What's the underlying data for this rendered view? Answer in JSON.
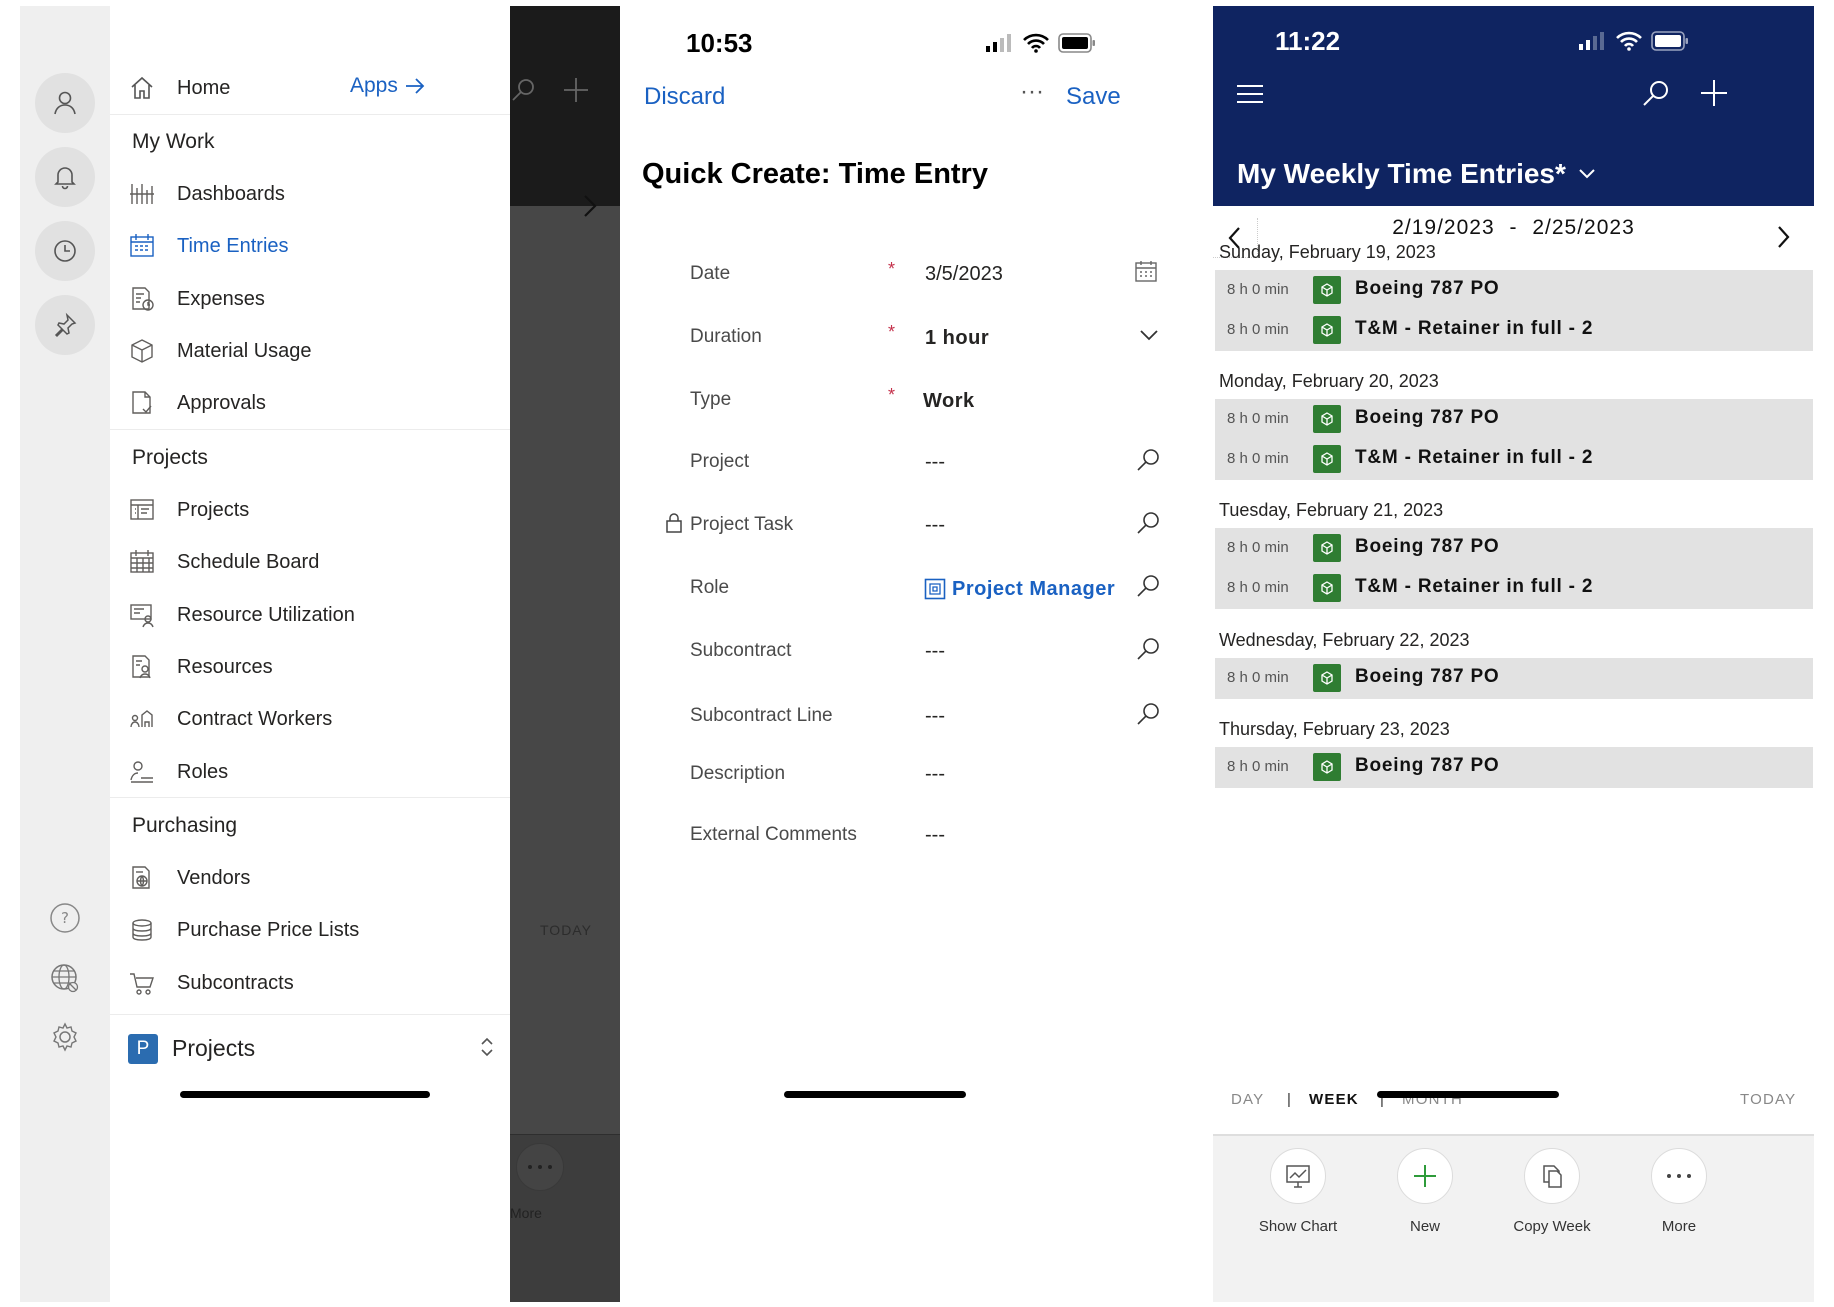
{
  "nav_panel": {
    "home_label": "Home",
    "apps_label": "Apps",
    "sections": {
      "my_work": "My Work",
      "projects": "Projects",
      "purchasing": "Purchasing"
    },
    "items": [
      {
        "id": "dashboards",
        "label": "Dashboards",
        "icon": "dashboard-icon",
        "selected": false
      },
      {
        "id": "time-entries",
        "label": "Time Entries",
        "icon": "calendar-icon",
        "selected": true
      },
      {
        "id": "expenses",
        "label": "Expenses",
        "icon": "expense-icon",
        "selected": false
      },
      {
        "id": "material-usage",
        "label": "Material Usage",
        "icon": "box-icon",
        "selected": false
      },
      {
        "id": "approvals",
        "label": "Approvals",
        "icon": "document-check-icon",
        "selected": false
      },
      {
        "id": "projects",
        "label": "Projects",
        "icon": "project-board-icon",
        "selected": false
      },
      {
        "id": "schedule-board",
        "label": "Schedule Board",
        "icon": "calendar-grid-icon",
        "selected": false
      },
      {
        "id": "resource-utilization",
        "label": "Resource Utilization",
        "icon": "resource-chart-icon",
        "selected": false
      },
      {
        "id": "resources",
        "label": "Resources",
        "icon": "resource-list-icon",
        "selected": false
      },
      {
        "id": "contract-workers",
        "label": "Contract Workers",
        "icon": "contract-workers-icon",
        "selected": false
      },
      {
        "id": "roles",
        "label": "Roles",
        "icon": "role-icon",
        "selected": false
      },
      {
        "id": "vendors",
        "label": "Vendors",
        "icon": "vendor-icon",
        "selected": false
      },
      {
        "id": "purchase-price-lists",
        "label": "Purchase Price Lists",
        "icon": "database-icon",
        "selected": false
      },
      {
        "id": "subcontracts",
        "label": "Subcontracts",
        "icon": "cart-icon",
        "selected": false
      }
    ],
    "app_switcher": {
      "badge": "P",
      "label": "Projects"
    },
    "background_toolbar": {
      "today_label": "TODAY",
      "more_label": "More"
    },
    "colors": {
      "accent": "#1a61c2",
      "app_badge": "#2b6cb0"
    }
  },
  "quick_create": {
    "status_time": "10:53",
    "discard_label": "Discard",
    "more_label": "···",
    "save_label": "Save",
    "title": "Quick Create: Time Entry",
    "fields": [
      {
        "label": "Date",
        "required": true,
        "value": "3/5/2023",
        "icon": "calendar-icon"
      },
      {
        "label": "Duration",
        "required": true,
        "value": "1 hour",
        "icon": "chevron-down-icon"
      },
      {
        "label": "Type",
        "required": true,
        "value": "Work",
        "icon": ""
      },
      {
        "label": "Project",
        "required": false,
        "value": "---",
        "icon": "search-icon"
      },
      {
        "label": "Project Task",
        "required": false,
        "value": "---",
        "icon": "search-icon",
        "locked": true
      },
      {
        "label": "Role",
        "required": false,
        "value": "Project Manager",
        "icon": "search-icon",
        "lookup": true
      },
      {
        "label": "Subcontract",
        "required": false,
        "value": "---",
        "icon": "search-icon"
      },
      {
        "label": "Subcontract Line",
        "required": false,
        "value": "---",
        "icon": "search-icon"
      },
      {
        "label": "Description",
        "required": false,
        "value": "---",
        "icon": ""
      },
      {
        "label": "External Comments",
        "required": false,
        "value": "---",
        "icon": ""
      }
    ],
    "required_mark": "*"
  },
  "weekly": {
    "status_time": "11:22",
    "view_title": "My Weekly Time Entries*",
    "range_start": "2/19/2023",
    "range_sep": "-",
    "range_end": "2/25/2023",
    "days": [
      {
        "label": "Sunday, February 19, 2023",
        "entries": [
          {
            "duration": "8 h 0 min",
            "project": "Boeing 787 PO"
          },
          {
            "duration": "8 h 0 min",
            "project": "T&M - Retainer in full - 2"
          }
        ]
      },
      {
        "label": "Monday, February 20, 2023",
        "entries": [
          {
            "duration": "8 h 0 min",
            "project": "Boeing 787 PO"
          },
          {
            "duration": "8 h 0 min",
            "project": "T&M - Retainer in full - 2"
          }
        ]
      },
      {
        "label": "Tuesday, February 21, 2023",
        "entries": [
          {
            "duration": "8 h 0 min",
            "project": "Boeing 787 PO"
          },
          {
            "duration": "8 h 0 min",
            "project": "T&M - Retainer in full - 2"
          }
        ]
      },
      {
        "label": "Wednesday, February 22, 2023",
        "entries": [
          {
            "duration": "8 h 0 min",
            "project": "Boeing 787 PO"
          }
        ]
      },
      {
        "label": "Thursday, February 23, 2023",
        "entries": [
          {
            "duration": "8 h 0 min",
            "project": "Boeing 787 PO"
          }
        ]
      }
    ],
    "view_modes": {
      "day": "DAY",
      "sep": "|",
      "week": "WEEK",
      "month": "MONTH",
      "today": "TODAY"
    },
    "toolbar": [
      {
        "label": "Show Chart",
        "icon": "chart-icon"
      },
      {
        "label": "New",
        "icon": "plus-icon"
      },
      {
        "label": "Copy Week",
        "icon": "copy-icon"
      },
      {
        "label": "More",
        "icon": "more-icon"
      }
    ],
    "colors": {
      "header": "#0f2461",
      "entry_tag": "#2f7d32",
      "entry_bg": "#e2e2e2"
    }
  }
}
